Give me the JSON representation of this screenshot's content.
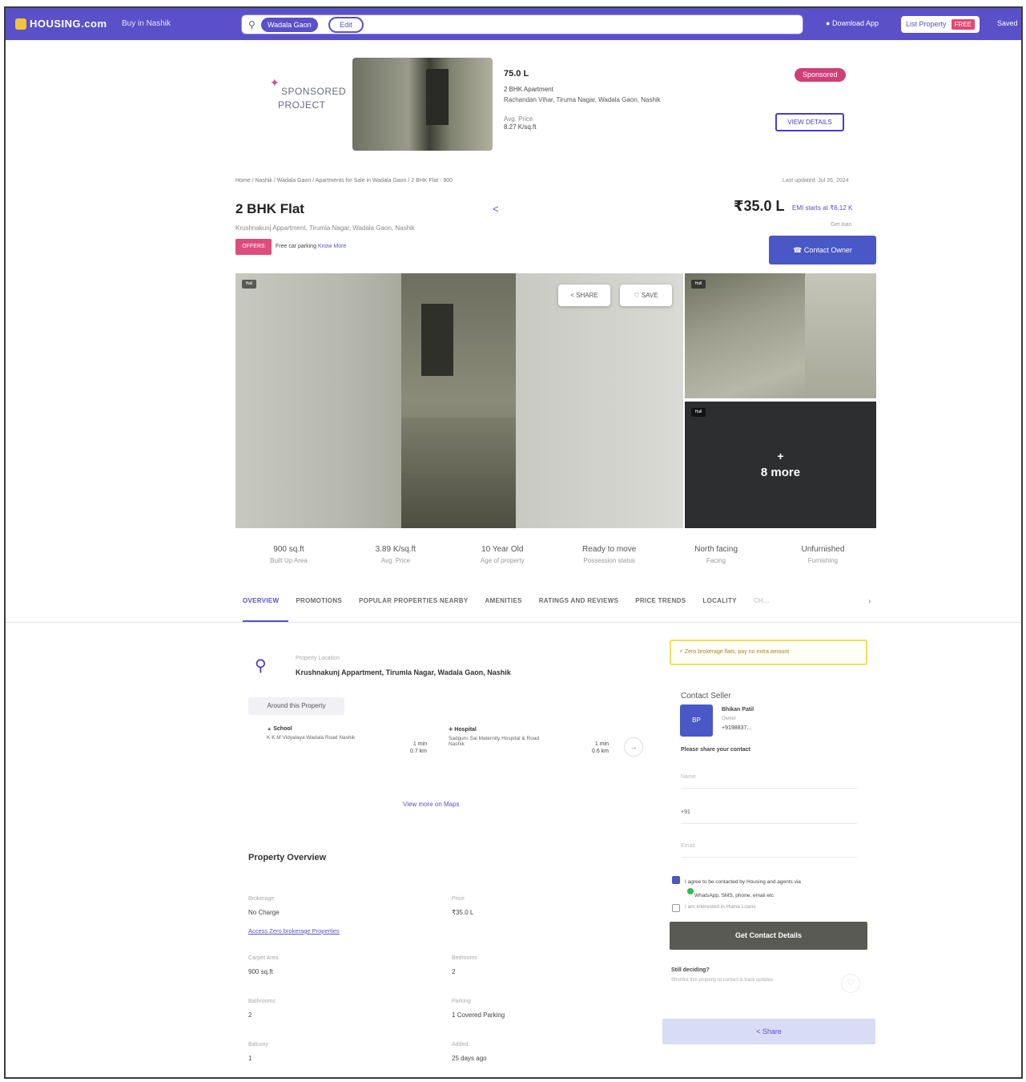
{
  "header": {
    "logo_text": "HOUSING.com",
    "buy_dropdown": "Buy in Nashik",
    "search_chip": "Wadala Gaon",
    "edit_chip": "Edit",
    "download_app": "Download App",
    "list_property": "List Property",
    "free_badge": "FREE",
    "user_menu": "Saved"
  },
  "sponsored": {
    "label_line1": "SPONSORED",
    "label_line2": "PROJECT",
    "price": "75.0 L",
    "type": "2 BHK Apartment",
    "address": "Rachandan Vihar, Tiruma Nagar, Wadala Gaon, Nashik",
    "avg_price_label": "Avg. Price",
    "avg_price_value": "8.27 K/sq.ft",
    "badge": "Sponsored",
    "button": "VIEW DETAILS"
  },
  "breadcrumb": "Home / Nashik / Wadala Gaon / Apartments for Sale in Wadala Gaon / 2 BHK Flat - 900",
  "last_updated": "Last updated: Jul 26, 2024",
  "listing": {
    "title": "2 BHK Flat",
    "address": "Krushnakunj Appartment, Tirumla Nagar, Wadala Gaon, Nashik",
    "tag": "OFFERS",
    "parking_note": "Free car parking",
    "know_more": "Know More",
    "price": "₹35.0 L",
    "emi": "EMI starts at ₹6.12 K",
    "price_sub": "Get loan",
    "contact_button": "Contact Owner"
  },
  "gallery": {
    "share": "SHARE",
    "save": "SAVE",
    "more_plus": "+",
    "more_label": "8 more",
    "photo_tag": "Hall"
  },
  "stats": [
    {
      "value": "900 sq.ft",
      "label": "Built Up Area"
    },
    {
      "value": "3.89 K/sq.ft",
      "label": "Avg. Price"
    },
    {
      "value": "10 Year Old",
      "label": "Age of property"
    },
    {
      "value": "Ready to move",
      "label": "Possession status"
    },
    {
      "value": "North facing",
      "label": "Facing"
    },
    {
      "value": "Unfurnished",
      "label": "Furnishing"
    }
  ],
  "tabs": [
    "OVERVIEW",
    "PROMOTIONS",
    "POPULAR PROPERTIES NEARBY",
    "AMENITIES",
    "RATINGS AND REVIEWS",
    "PRICE TRENDS",
    "LOCALITY",
    "CH..."
  ],
  "location": {
    "label": "Property Location",
    "value": "Krushnakunj Appartment, Tirumla Nagar, Wadala Gaon, Nashik",
    "around_button": "Around this Property",
    "nearby": [
      {
        "category": "School",
        "name": "K K M Vidyalaya Wadala Road Nashik",
        "time": "1 min",
        "dist": "0.7 km"
      },
      {
        "category": "Hospital",
        "name": "Sadguru Sai Maternity Hospital & Road Nashik",
        "time": "1 min",
        "dist": "0.6 km"
      }
    ],
    "view_maps": "View more on Maps"
  },
  "overview": {
    "title": "Property Overview",
    "link": "Access Zero brokerage Properties",
    "items": [
      {
        "label": "Brokerage",
        "value": "No Charge"
      },
      {
        "label": "Price",
        "value": "₹35.0 L"
      },
      {
        "label": "Carpet Area",
        "value": "900 sq.ft"
      },
      {
        "label": "Bedrooms",
        "value": "2"
      },
      {
        "label": "Bathrooms",
        "value": "2"
      },
      {
        "label": "Parking",
        "value": "1 Covered Parking"
      },
      {
        "label": "Balcony",
        "value": "1"
      },
      {
        "label": "Added",
        "value": "25 days ago"
      }
    ]
  },
  "contact": {
    "notice": "Zero brokerage flats, pay no extra amount",
    "heading": "Contact Seller",
    "avatar_text": "BP",
    "seller_name": "Bhikan Patil",
    "seller_role": "Owner",
    "seller_phone": "+9198837...",
    "share_contact": "Please share your contact",
    "field_name": "Name",
    "field_phone": "+91",
    "field_email": "Email",
    "agree_text": "I agree to be contacted by Housing and agents via",
    "agree_text2": "WhatsApp, SMS, phone, email etc",
    "loan_text": "I am interested in Home Loans",
    "get_contact": "Get Contact Details",
    "still_deciding": "Still deciding?",
    "still_deciding_sub": "Shortlist this property to contact & track updates",
    "share_bottom": "Share"
  }
}
